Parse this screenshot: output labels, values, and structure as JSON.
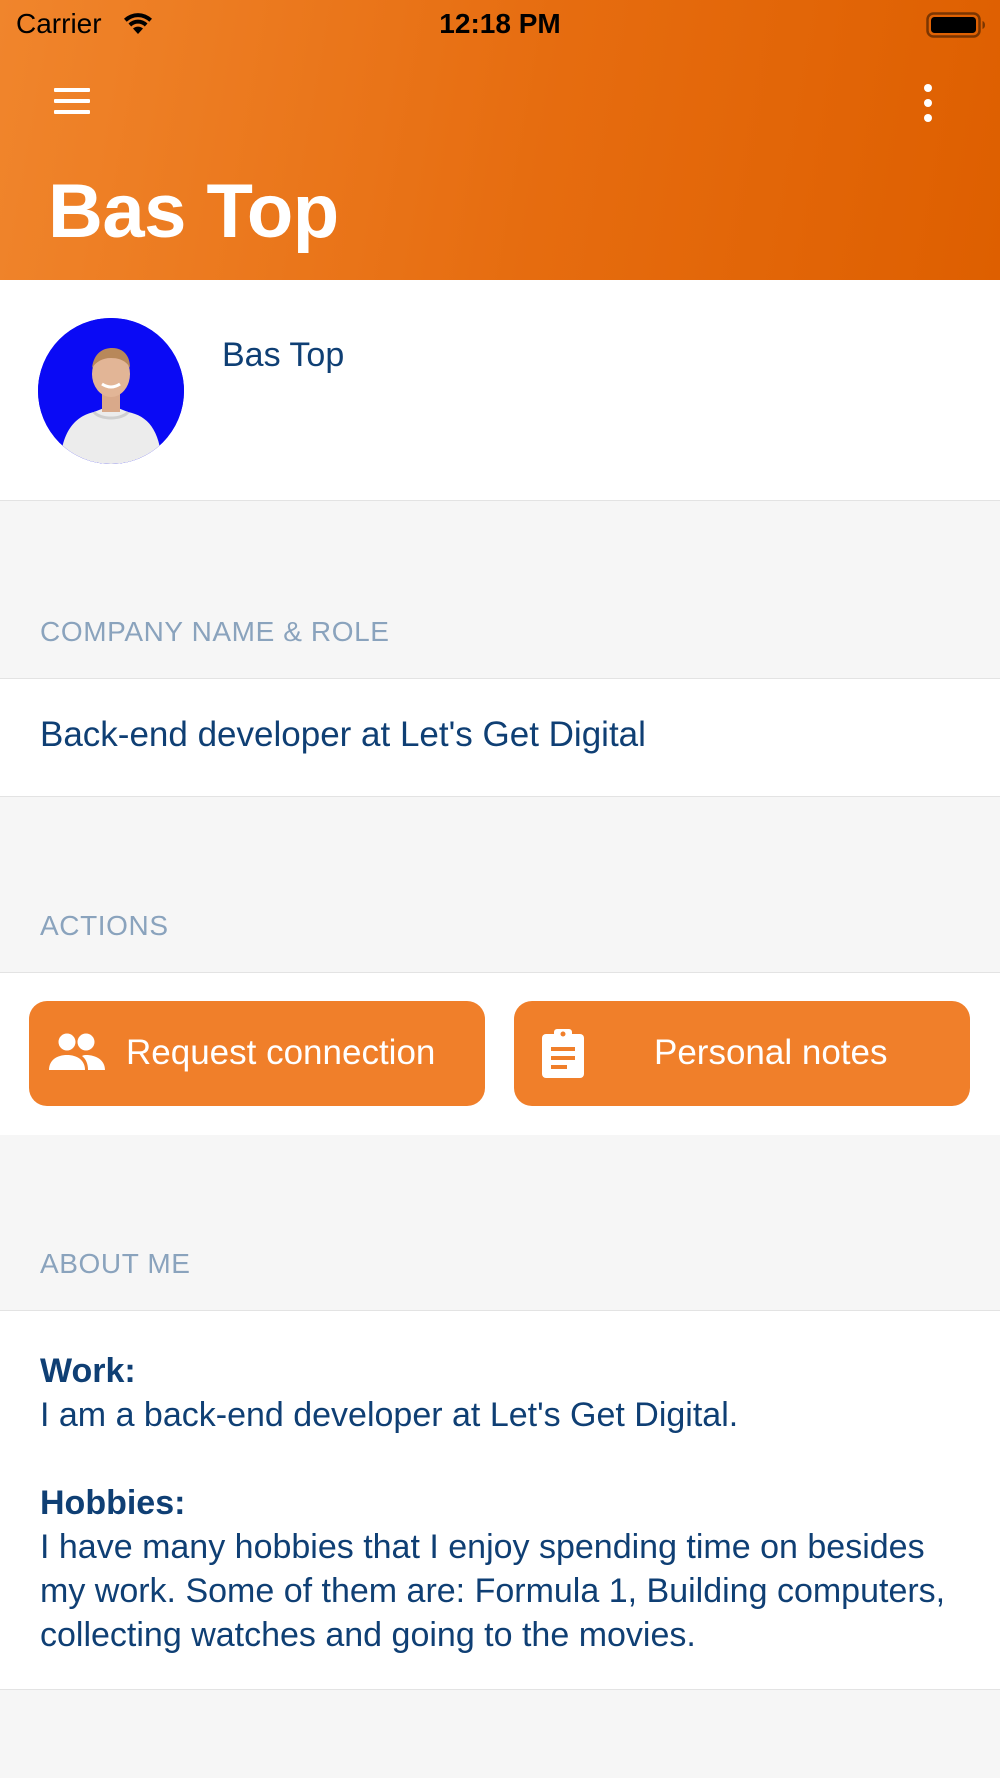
{
  "status_bar": {
    "carrier": "Carrier",
    "time": "12:18 PM"
  },
  "header": {
    "title": "Bas Top"
  },
  "profile": {
    "name": "Bas Top"
  },
  "sections": {
    "company": {
      "label": "COMPANY NAME & ROLE",
      "value": "Back-end developer at Let's Get Digital"
    },
    "actions": {
      "label": "ACTIONS",
      "request_label": "Request connection",
      "notes_label": "Personal notes"
    },
    "about": {
      "label": "ABOUT ME",
      "work_heading": "Work:",
      "work_text": "I am a back-end developer at Let's Get Digital.",
      "hobbies_heading": "Hobbies:",
      "hobbies_text": "I have many hobbies that I enjoy spending time on besides my work. Some of them are: Formula 1, Building computers, collecting watches and going to the movies."
    }
  },
  "icons": [
    "wifi-icon",
    "battery-icon",
    "menu-icon",
    "more-vertical-icon",
    "people-icon",
    "clipboard-icon"
  ],
  "colors": {
    "header_start": "#f0852c",
    "header_end": "#de5f00",
    "button": "#f07f2a",
    "text": "#0f3f74",
    "label": "#8aa3bd"
  }
}
